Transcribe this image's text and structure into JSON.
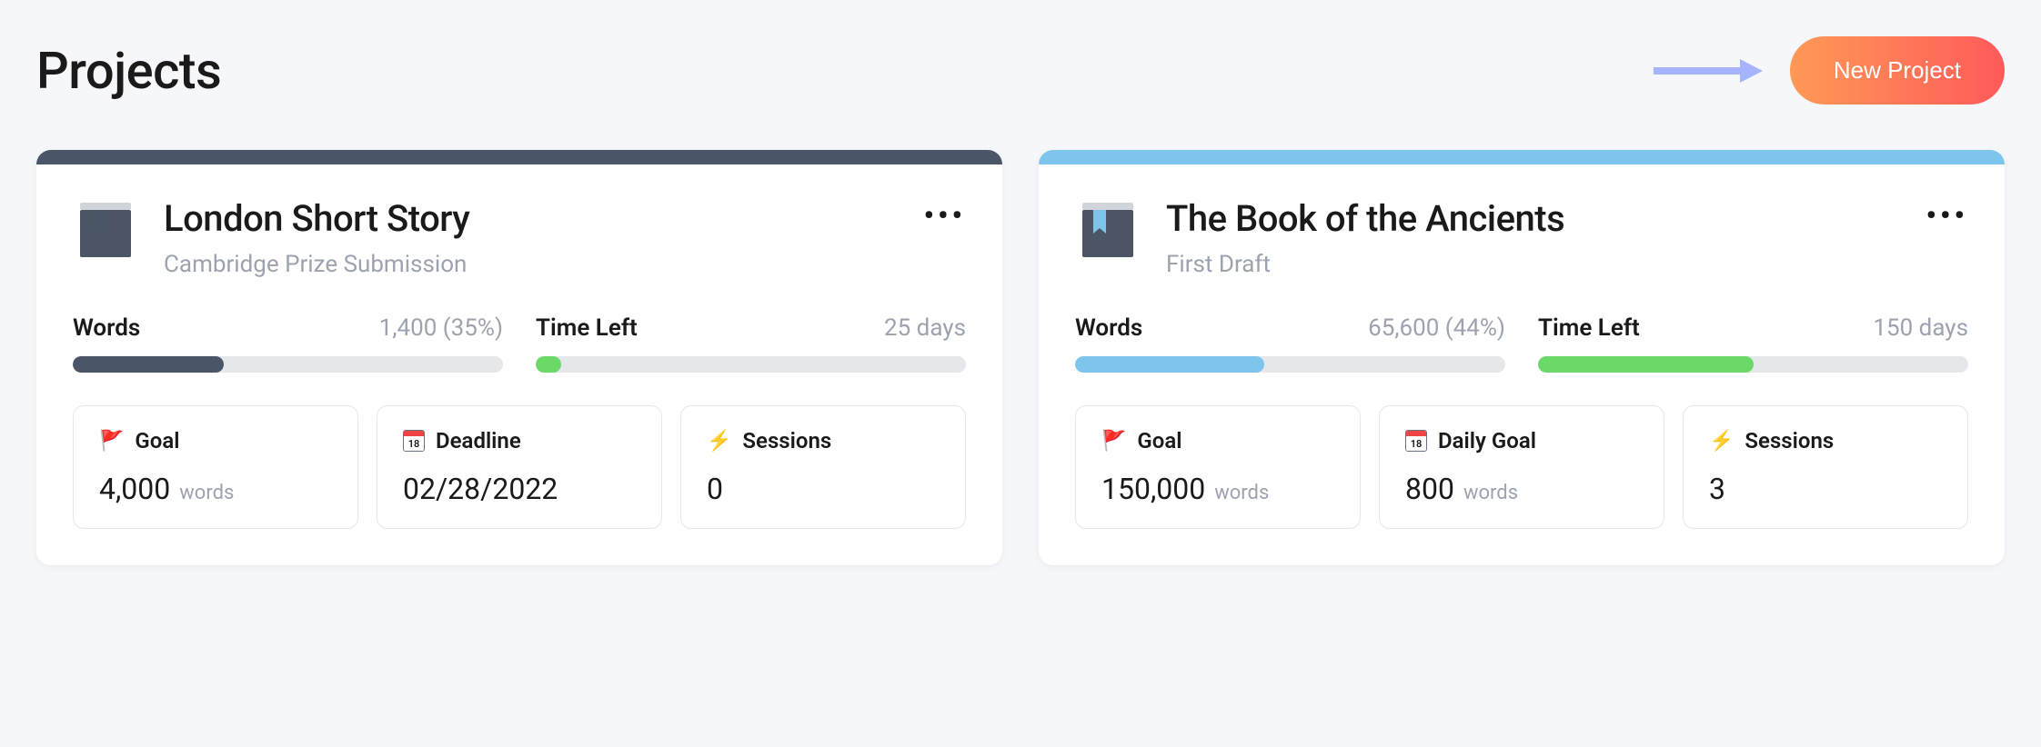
{
  "page_title": "Projects",
  "new_project_label": "New Project",
  "projects": [
    {
      "title": "London Short Story",
      "subtitle": "Cambridge Prize Submission",
      "accent": "dark",
      "bookmark_color": "#4a5568",
      "words_label": "Words",
      "words_value": "1,400 (35%)",
      "words_pct": 35,
      "time_label": "Time Left",
      "time_value": "25 days",
      "time_pct": 6,
      "stats": [
        {
          "icon": "flag",
          "label": "Goal",
          "value": "4,000",
          "unit": "words"
        },
        {
          "icon": "calendar",
          "cal_day": "18",
          "label": "Deadline",
          "value": "02/28/2022",
          "unit": ""
        },
        {
          "icon": "bolt",
          "label": "Sessions",
          "value": "0",
          "unit": ""
        }
      ]
    },
    {
      "title": "The Book of the Ancients",
      "subtitle": "First Draft",
      "accent": "blue",
      "bookmark_color": "#7ec5ed",
      "words_label": "Words",
      "words_value": "65,600 (44%)",
      "words_pct": 44,
      "time_label": "Time Left",
      "time_value": "150 days",
      "time_pct": 50,
      "stats": [
        {
          "icon": "flag",
          "label": "Goal",
          "value": "150,000",
          "unit": "words"
        },
        {
          "icon": "calendar",
          "cal_day": "18",
          "label": "Daily Goal",
          "value": "800",
          "unit": "words"
        },
        {
          "icon": "bolt",
          "label": "Sessions",
          "value": "3",
          "unit": ""
        }
      ]
    }
  ]
}
